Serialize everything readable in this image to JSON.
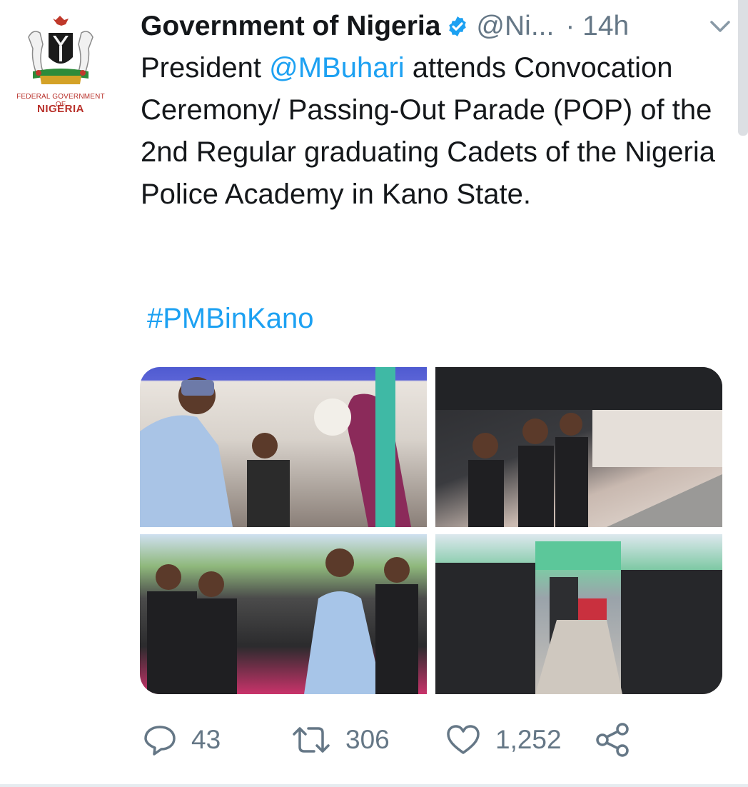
{
  "avatar": {
    "caption_line1": "FEDERAL GOVERNMENT OF",
    "caption_line2": "NIGERIA"
  },
  "tweet": {
    "display_name": "Government of Nigeria",
    "handle": "@Ni...",
    "time": "· 14h",
    "text_before": "President ",
    "mention": "@MBuhari",
    "text_after": " attends Convocation Ceremony/ Passing-Out Parade (POP) of the 2nd Regular graduating Cadets of the Nigeria Police Academy in Kano State.",
    "hashtag": "#PMBinKano"
  },
  "actions": {
    "replies": "43",
    "retweets": "306",
    "likes": "1,252"
  },
  "colors": {
    "link": "#1da1f2",
    "muted": "#657786",
    "verified": "#1da1f2"
  },
  "icons": [
    "coat-of-arms-icon",
    "verified-badge-icon",
    "chevron-down-icon",
    "reply-icon",
    "retweet-icon",
    "like-icon",
    "share-icon"
  ]
}
